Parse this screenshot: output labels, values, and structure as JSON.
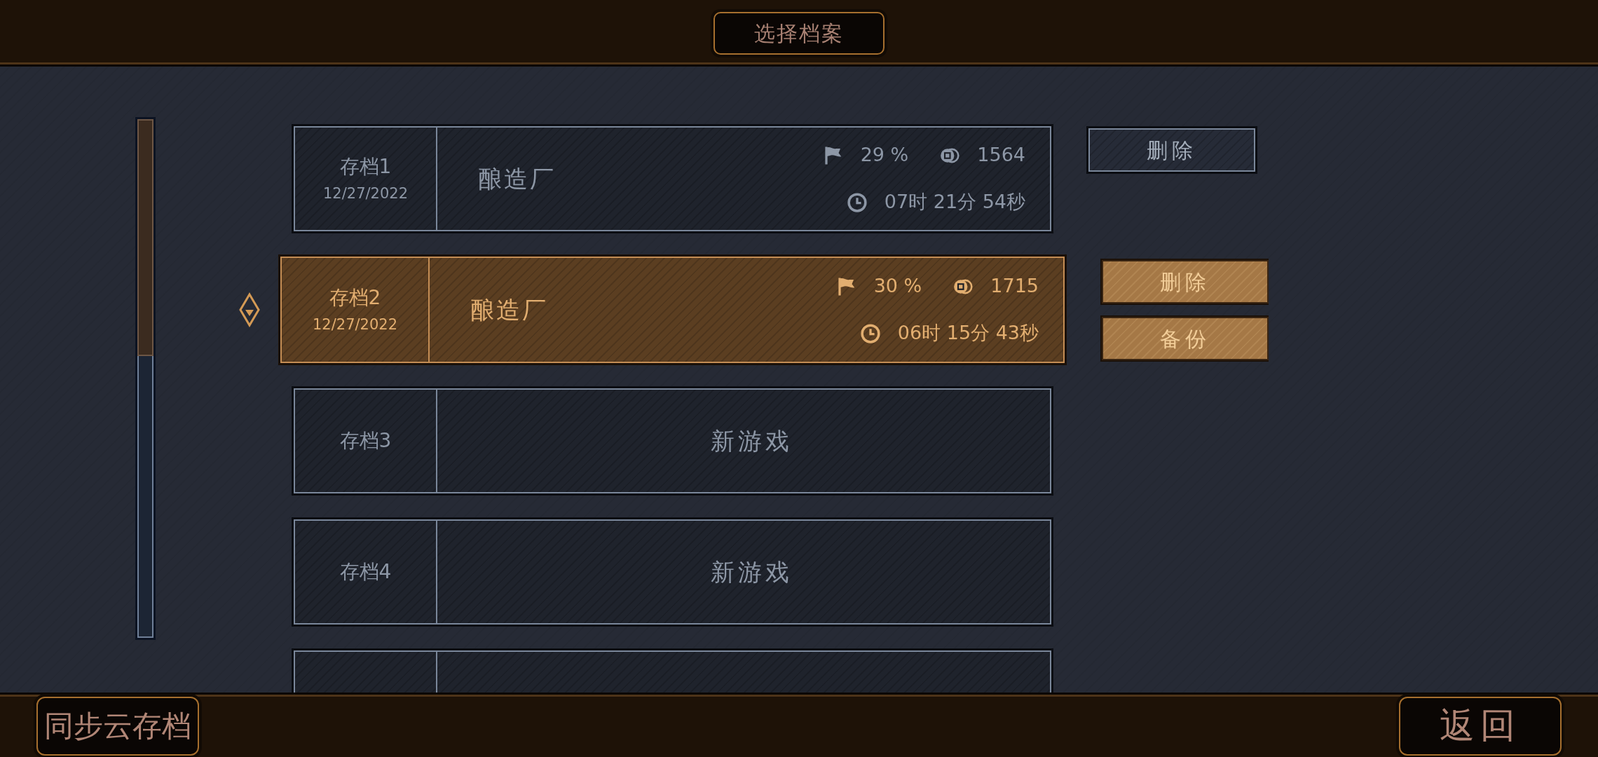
{
  "header": {
    "title": "选择档案"
  },
  "save_slots": [
    {
      "kind": "saved",
      "selected": false,
      "label": "存档1",
      "date": "12/27/2022",
      "name": "酿造厂",
      "progress": "29 %",
      "coins": "1564",
      "playtime": "07时 21分 54秒",
      "actions": [
        "删除"
      ]
    },
    {
      "kind": "saved",
      "selected": true,
      "label": "存档2",
      "date": "12/27/2022",
      "name": "酿造厂",
      "progress": "30 %",
      "coins": "1715",
      "playtime": "06时 15分 43秒",
      "actions": [
        "删除",
        "备份"
      ]
    },
    {
      "kind": "empty",
      "selected": false,
      "label": "存档3",
      "status": "新游戏"
    },
    {
      "kind": "empty",
      "selected": false,
      "label": "存档4",
      "status": "新游戏"
    },
    {
      "selected": false
    }
  ],
  "footer": {
    "sync_button": "同步云存档",
    "back_button": "返回"
  }
}
